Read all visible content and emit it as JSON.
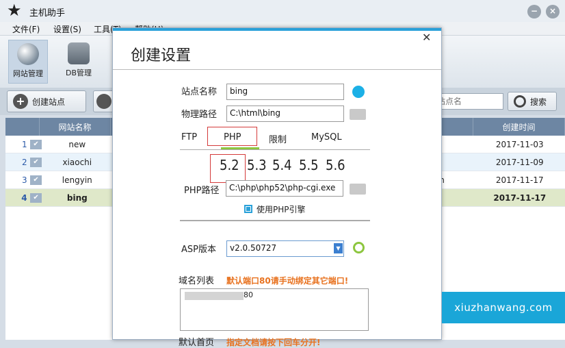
{
  "app": {
    "title": "主机助手"
  },
  "menu": [
    "文件(F)",
    "设置(S)",
    "工具(T)",
    "帮助(H)"
  ],
  "toolbar": {
    "sites": "网站管理",
    "db": "DB管理"
  },
  "actions": {
    "create_site": "创建站点",
    "search_placeholder": "站点名",
    "search_button": "搜索"
  },
  "grid": {
    "headers": {
      "name": "网站名称",
      "created": "创建时间"
    },
    "rows": [
      {
        "num": "1",
        "name": "new",
        "extra": "",
        "date": "2017-11-03"
      },
      {
        "num": "2",
        "name": "xiaochi",
        "extra": "i",
        "date": "2017-11-09"
      },
      {
        "num": "3",
        "name": "lengyin",
        "extra": "n",
        "date": "2017-11-17"
      },
      {
        "num": "4",
        "name": "bing",
        "extra": "",
        "date": "2017-11-17"
      }
    ]
  },
  "dialog": {
    "title": "创建设置",
    "site_name_label": "站点名称",
    "site_name": "bing",
    "path_label": "物理路径",
    "path": "C:\\html\\bing",
    "tabs": [
      "FTP",
      "PHP",
      "限制",
      "MySQL"
    ],
    "php_versions": [
      "5.2",
      "5.3",
      "5.4",
      "5.5",
      "5.6"
    ],
    "php_path_label": "PHP路径",
    "php_path": "C:\\php\\php52\\php-cgi.exe",
    "use_php": "使用PHP引擎",
    "asp_label": "ASP版本",
    "asp_version": "v2.0.50727",
    "domain_label": "域名列表",
    "domain_note": "默认端口80请手动绑定其它端口!",
    "domain_value": "80",
    "next_label": "默认首页",
    "next_note": "指定文档请按下回车分开!"
  },
  "colors": {
    "accent": "#2aa1d9",
    "circle_blue": "#1cb0e6",
    "circle_green": "#8dc63f",
    "note": "#e8721f",
    "highlight": "#d43a3a"
  },
  "watermark": "xiuzhanwang.com"
}
